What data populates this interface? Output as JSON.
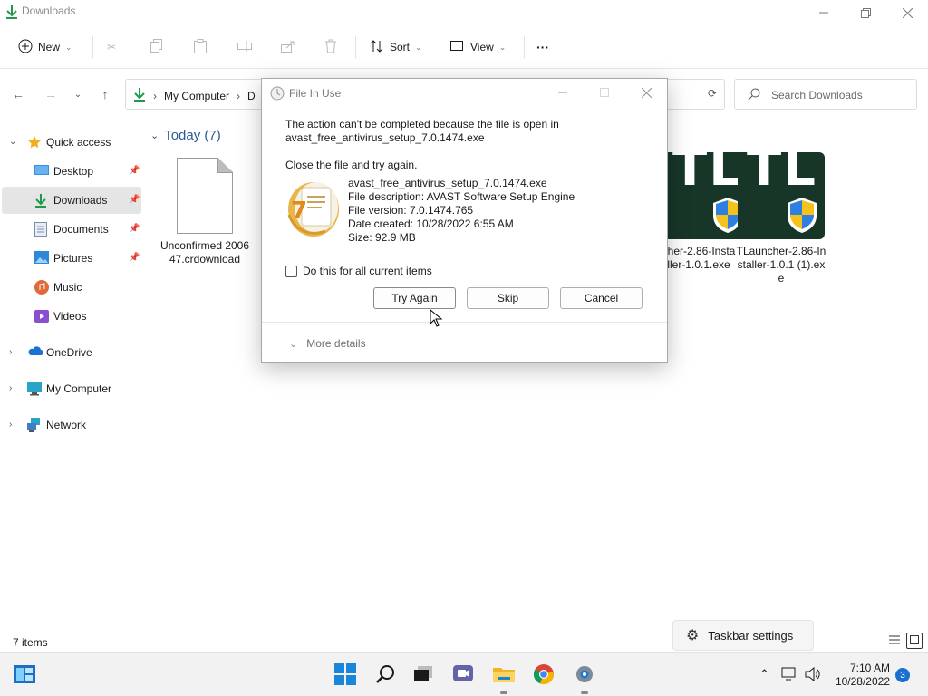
{
  "window": {
    "title": "Downloads"
  },
  "toolbar": {
    "new_label": "New",
    "sort_label": "Sort",
    "view_label": "View",
    "more_label": "···"
  },
  "address": {
    "crumb_1": "My Computer",
    "crumb_2": "D",
    "search_placeholder": "Search Downloads"
  },
  "sidebar": {
    "quick_access": "Quick access",
    "items": [
      {
        "label": "Desktop"
      },
      {
        "label": "Downloads"
      },
      {
        "label": "Documents"
      },
      {
        "label": "Pictures"
      },
      {
        "label": "Music"
      },
      {
        "label": "Videos"
      }
    ],
    "onedrive": "OneDrive",
    "my_computer": "My Computer",
    "network": "Network"
  },
  "content": {
    "group_header": "Today (7)",
    "files": [
      {
        "name": "Unconfirmed 200647.crdownload"
      },
      {
        "name": "cher-2.86-Installer-1.0.1.exe"
      },
      {
        "name": "TLauncher-2.86-Installer-1.0.1 (1).exe"
      }
    ]
  },
  "status": {
    "item_count": "7 items"
  },
  "taskbar_settings": {
    "label": "Taskbar settings"
  },
  "clock": {
    "time": "7:10 AM",
    "date": "10/28/2022",
    "notifications": "3"
  },
  "dialog": {
    "title": "File In Use",
    "message_line1": "The action can't be completed because the file is open in",
    "message_line2": "avast_free_antivirus_setup_7.0.1474.exe",
    "instruction": "Close the file and try again.",
    "info": {
      "filename": "avast_free_antivirus_setup_7.0.1474.exe",
      "description": "File description: AVAST Software Setup Engine",
      "version": "File version: 7.0.1474.765",
      "created": "Date created: 10/28/2022 6:55 AM",
      "size": "Size: 92.9 MB"
    },
    "checkbox_label": "Do this for all current items",
    "try_again": "Try Again",
    "skip": "Skip",
    "cancel": "Cancel",
    "more_details": "More details"
  },
  "colors": {
    "accent_blue": "#2a5a96",
    "taskbar_bg": "#f2f2f2",
    "selected_bg": "#e5e5e5"
  }
}
